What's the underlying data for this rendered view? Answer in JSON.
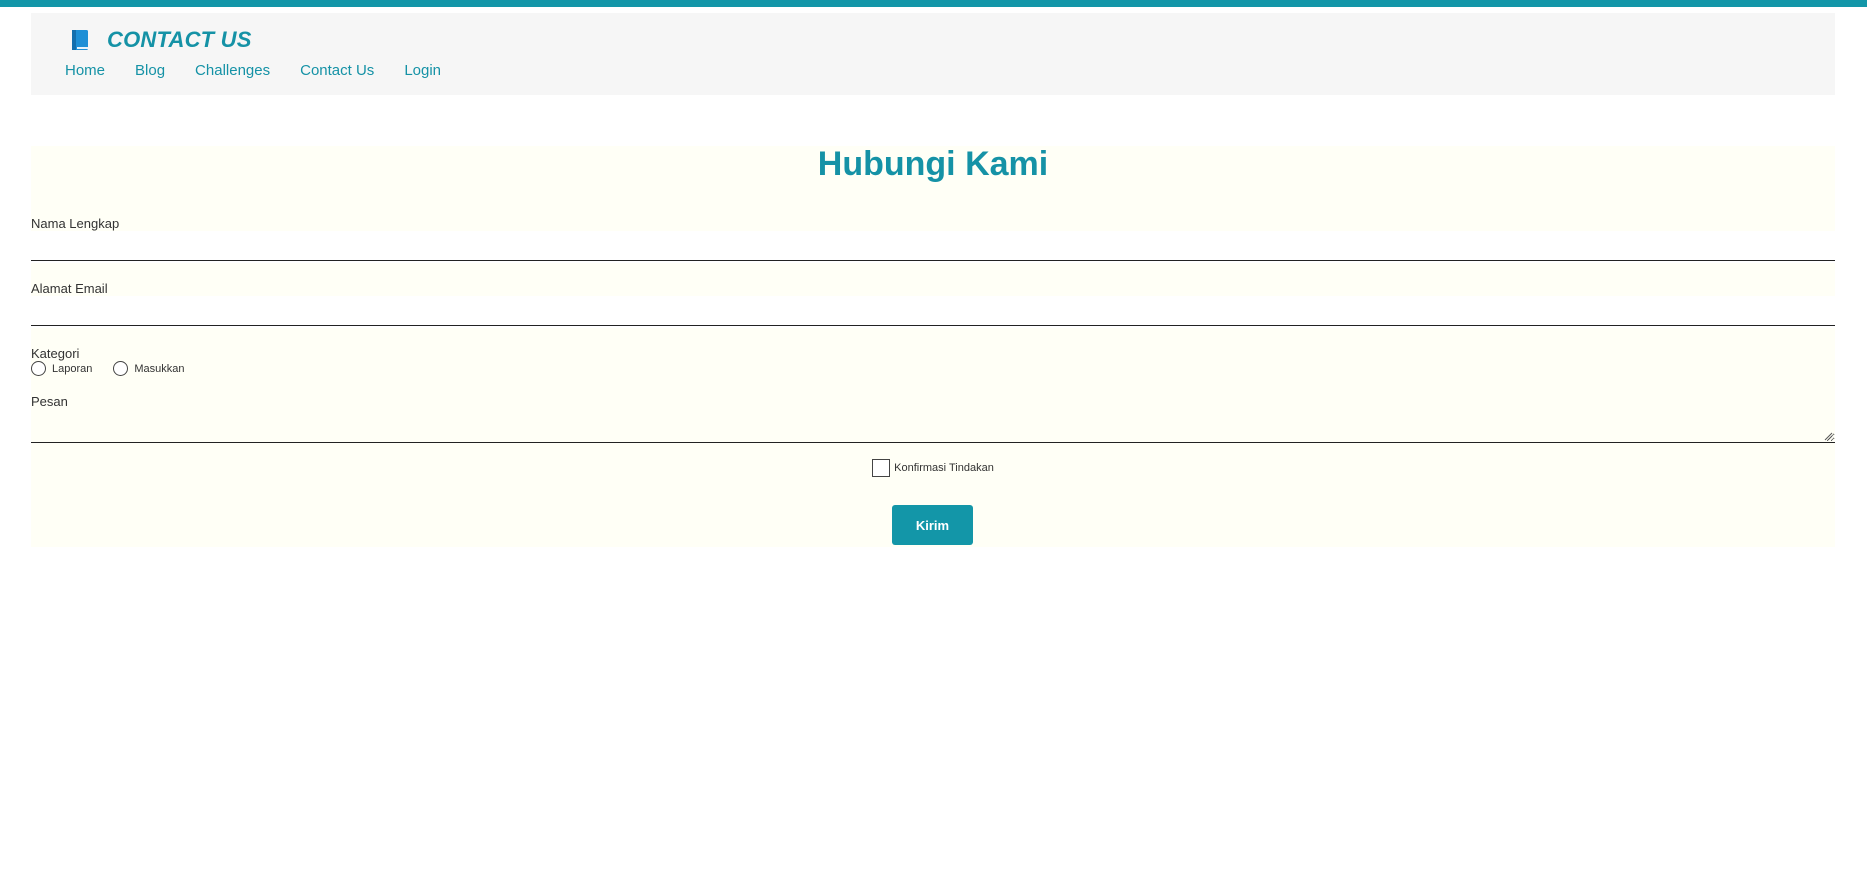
{
  "header": {
    "brand_icon": "book-icon",
    "brand_title": "CONTACT US",
    "nav": [
      "Home",
      "Blog",
      "Challenges",
      "Contact Us",
      "Login"
    ]
  },
  "form": {
    "title": "Hubungi Kami",
    "name_label": "Nama Lengkap",
    "name_value": "",
    "email_label": "Alamat Email",
    "email_value": "",
    "category_label": "Kategori",
    "category_options": [
      "Laporan",
      "Masukkan"
    ],
    "message_label": "Pesan",
    "message_value": "",
    "confirm_label": "Konfirmasi Tindakan",
    "submit_label": "Kirim"
  },
  "colors": {
    "accent": "#1396a8",
    "header_bg": "#f6f6f6",
    "form_bg": "#fffff6"
  }
}
